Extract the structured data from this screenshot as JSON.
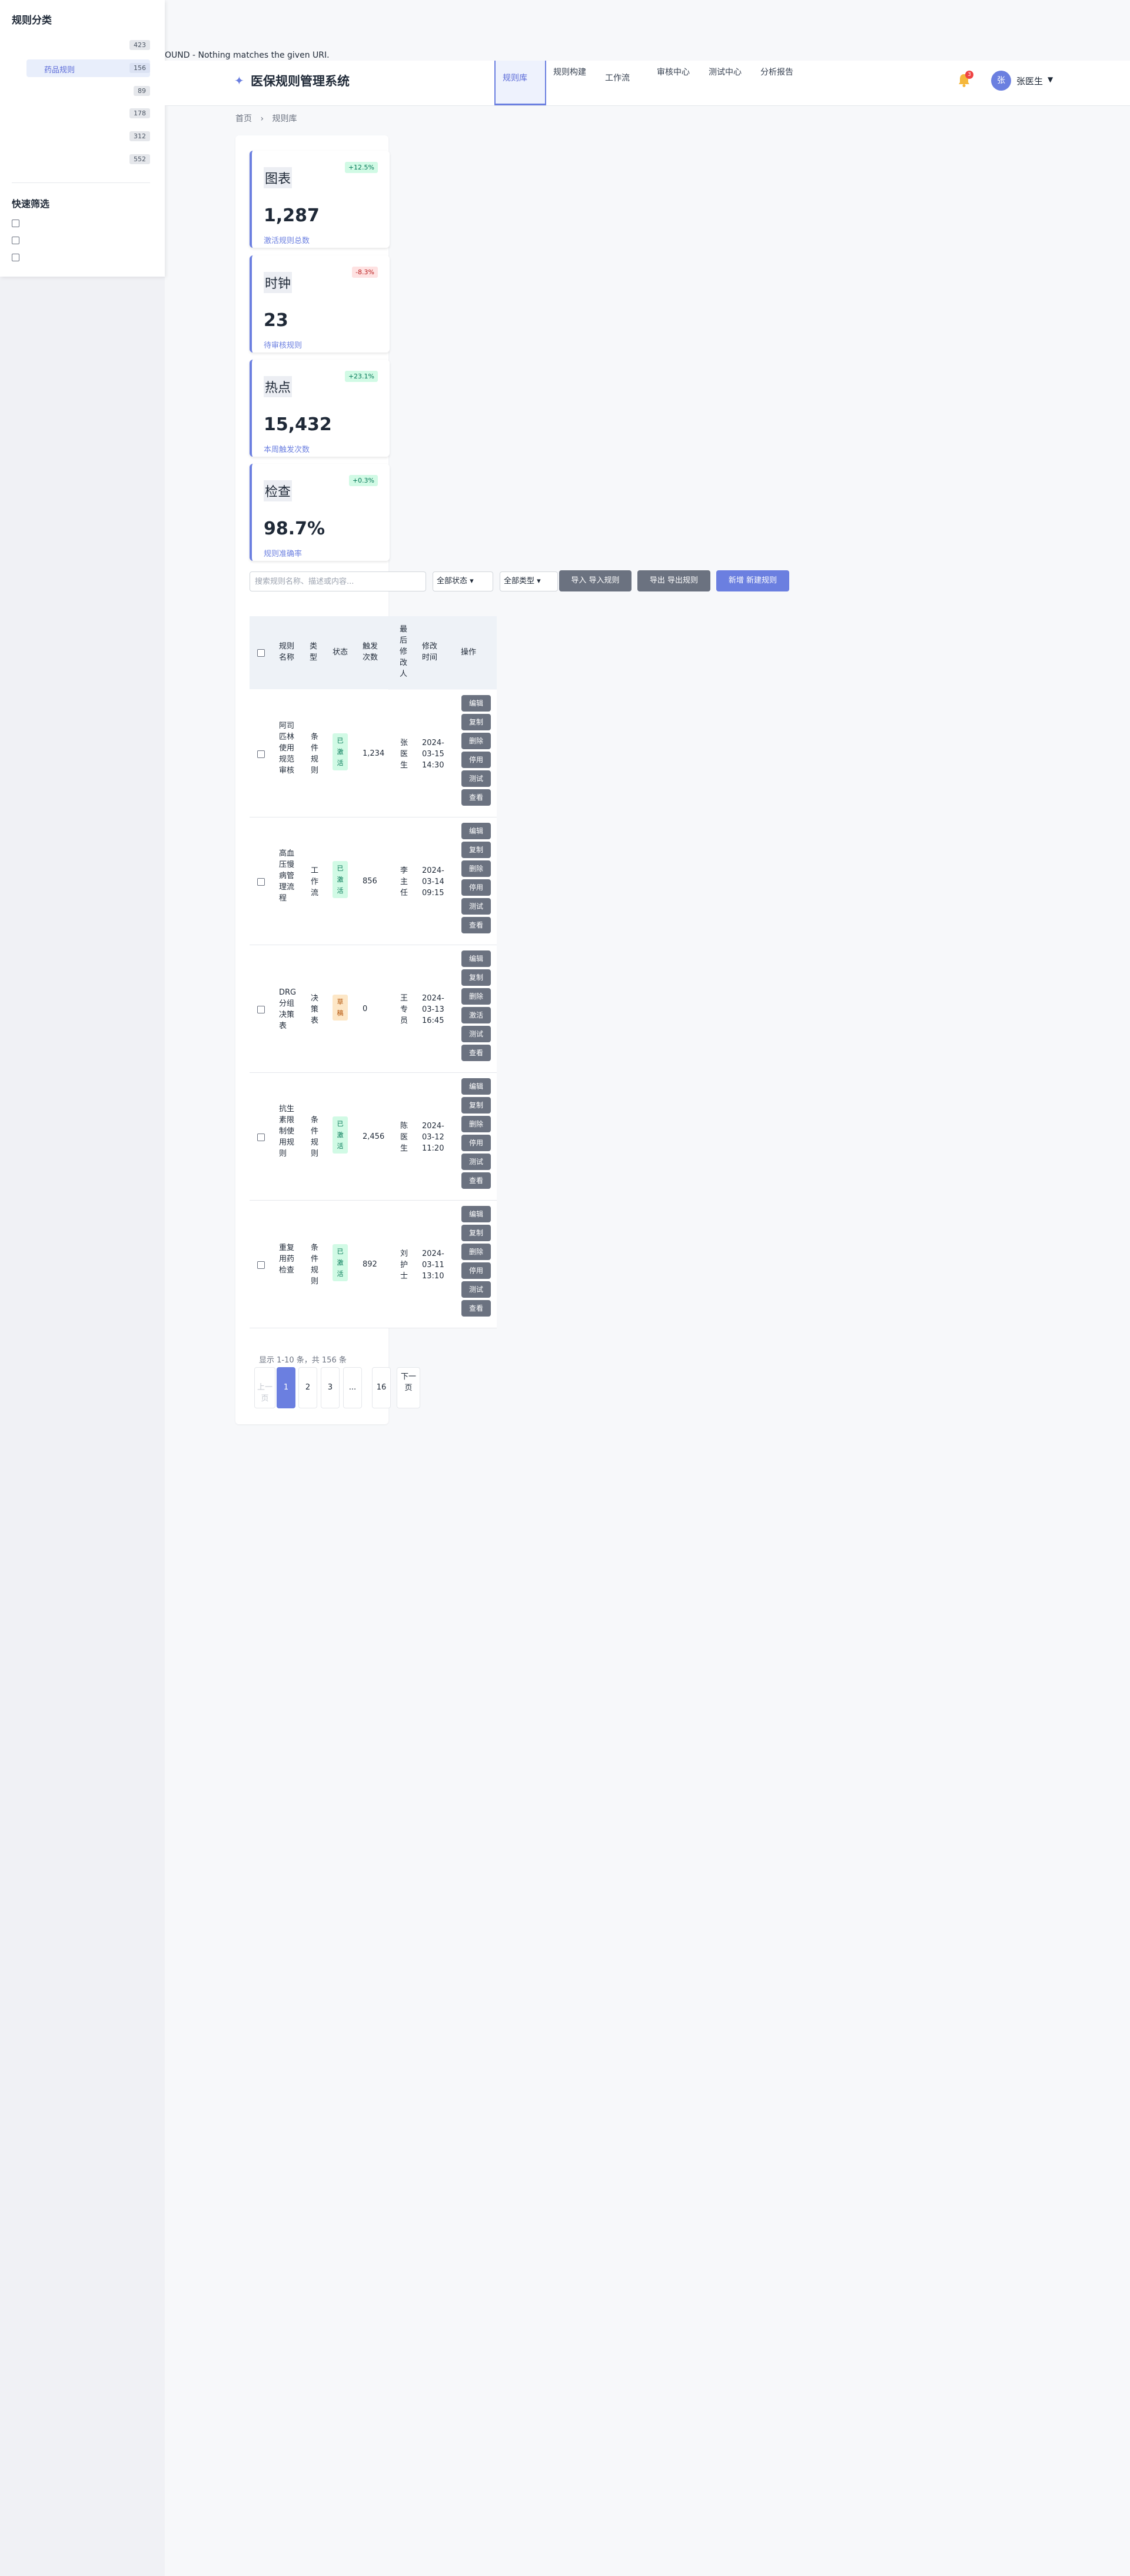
{
  "sidebar": {
    "title": "规则分类",
    "categories": [
      {
        "label": "",
        "count": "423"
      },
      {
        "label": "药品规则",
        "count": "156"
      },
      {
        "label": "",
        "count": "89"
      },
      {
        "label": "",
        "count": "178"
      },
      {
        "label": "",
        "count": "312"
      },
      {
        "label": "",
        "count": "552"
      }
    ],
    "quick_filter_title": "快速筛选"
  },
  "error_text": "OUND - Nothing matches the given URI.",
  "header": {
    "brand": "医保规则管理系统",
    "nav": [
      {
        "label": "规则库"
      },
      {
        "label": "规则构建"
      },
      {
        "label": "工作流"
      },
      {
        "label": "审核中心"
      },
      {
        "label": "测试中心"
      },
      {
        "label": "分析报告"
      }
    ],
    "notification_count": "3",
    "avatar_initial": "张",
    "user_name": "张医生",
    "user_caret": "▼"
  },
  "breadcrumb": [
    "首页",
    "›",
    "规则库"
  ],
  "stats": [
    {
      "icon": "图表",
      "change": "+12.5%",
      "trend": "up",
      "value": "1,287",
      "label": "激活规则总数"
    },
    {
      "icon": "时钟",
      "change": "-8.3%",
      "trend": "down",
      "value": "23",
      "label": "待审核规则"
    },
    {
      "icon": "热点",
      "change": "+23.1%",
      "trend": "up",
      "value": "15,432",
      "label": "本周触发次数"
    },
    {
      "icon": "检查",
      "change": "+0.3%",
      "trend": "up",
      "value": "98.7%",
      "label": "规则准确率"
    }
  ],
  "toolbar": {
    "search_placeholder": "搜索规则名称、描述或内容...",
    "status_select": "全部状态",
    "type_select": "全部类型",
    "import_label": "导入 导入规则",
    "export_label": "导出 导出规则",
    "new_label": "新增 新建规则"
  },
  "table": {
    "headers": {
      "name": "规则名称",
      "type": "类型",
      "status": "状态",
      "triggers": "触发次数",
      "editor": "最后修改人",
      "modified": "修改时间",
      "actions": "操作"
    },
    "rows": [
      {
        "name": "阿司匹林使用规范审核",
        "type": "条件规则",
        "status": "已激活",
        "status_kind": "on",
        "triggers": "1,234",
        "editor": "张医生",
        "modified": "2024-03-15 14:30"
      },
      {
        "name": "高血压慢病管理流程",
        "type": "工作流",
        "status": "已激活",
        "status_kind": "on",
        "triggers": "856",
        "editor": "李主任",
        "modified": "2024-03-14 09:15"
      },
      {
        "name": "DRG分组决策表",
        "type": "决策表",
        "status": "草稿",
        "status_kind": "draft",
        "triggers": "0",
        "editor": "王专员",
        "modified": "2024-03-13 16:45"
      },
      {
        "name": "抗生素限制使用规则",
        "type": "条件规则",
        "status": "已激活",
        "status_kind": "on",
        "triggers": "2,456",
        "editor": "陈医生",
        "modified": "2024-03-12 11:20"
      },
      {
        "name": "重复用药检查",
        "type": "条件规则",
        "status": "已激活",
        "status_kind": "on",
        "triggers": "892",
        "editor": "刘护士",
        "modified": "2024-03-11 13:10"
      }
    ],
    "actions": [
      "编辑",
      "复制",
      "删除",
      "停用",
      "测试",
      "查看"
    ],
    "row3_actions": [
      "编辑",
      "复制",
      "删除",
      "激活",
      "测试",
      "查看"
    ]
  },
  "pagination": {
    "info": "显示 1-10 条，共 156 条",
    "prev": "上一页",
    "pages": [
      "1",
      "2",
      "3",
      "...",
      "16"
    ],
    "next": "下一页"
  },
  "colors": {
    "accent": "#6b7fe0",
    "success_bg": "#d1fae5",
    "danger_bg": "#fee2e2",
    "draft_bg": "#fde7c7",
    "action_gray": "#6b7280"
  }
}
